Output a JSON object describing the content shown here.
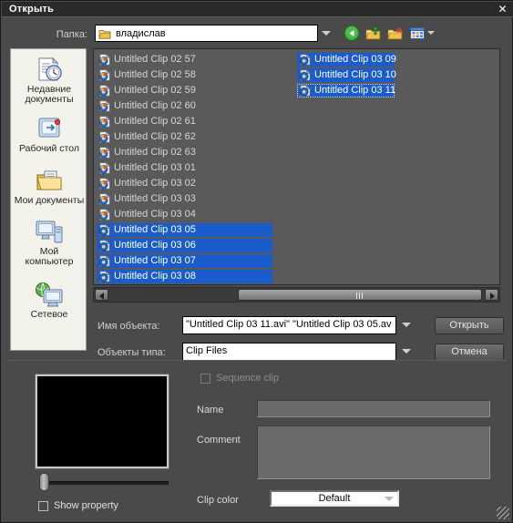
{
  "window": {
    "title": "Открыть",
    "close_label": "✕"
  },
  "toolbar": {
    "lookin_label": "Папка:",
    "lookin_value": "владислав",
    "icons": {
      "folder": "folder-icon",
      "back": "back-arrow-icon",
      "up": "up-one-level-icon",
      "new_folder": "new-folder-icon",
      "views": "views-icon"
    }
  },
  "places": [
    {
      "label_line1": "Недавние",
      "label_line2": "документы",
      "icon": "recent-documents-icon"
    },
    {
      "label_line1": "Рабочий стол",
      "label_line2": "",
      "icon": "desktop-icon"
    },
    {
      "label_line1": "Мои документы",
      "label_line2": "",
      "icon": "my-documents-icon"
    },
    {
      "label_line1": "Мой",
      "label_line2": "компьютер",
      "icon": "my-computer-icon"
    },
    {
      "label_line1": "Сетевое",
      "label_line2": "",
      "icon": "network-icon"
    }
  ],
  "files": {
    "column1": [
      {
        "name": "Untitled Clip 02 57",
        "selected": false,
        "focused": false
      },
      {
        "name": "Untitled Clip 02 58",
        "selected": false,
        "focused": false
      },
      {
        "name": "Untitled Clip 02 59",
        "selected": false,
        "focused": false
      },
      {
        "name": "Untitled Clip 02 60",
        "selected": false,
        "focused": false
      },
      {
        "name": "Untitled Clip 02 61",
        "selected": false,
        "focused": false
      },
      {
        "name": "Untitled Clip 02 62",
        "selected": false,
        "focused": false
      },
      {
        "name": "Untitled Clip 02 63",
        "selected": false,
        "focused": false
      },
      {
        "name": "Untitled Clip 03 01",
        "selected": false,
        "focused": false
      },
      {
        "name": "Untitled Clip 03 02",
        "selected": false,
        "focused": false
      },
      {
        "name": "Untitled Clip 03 03",
        "selected": false,
        "focused": false
      },
      {
        "name": "Untitled Clip 03 04",
        "selected": false,
        "focused": false
      },
      {
        "name": "Untitled Clip 03 05",
        "selected": true,
        "focused": false
      },
      {
        "name": "Untitled Clip 03 06",
        "selected": true,
        "focused": false
      },
      {
        "name": "Untitled Clip 03 07",
        "selected": true,
        "focused": false
      },
      {
        "name": "Untitled Clip 03 08",
        "selected": true,
        "focused": false
      }
    ],
    "column2": [
      {
        "name": "Untitled Clip 03 09",
        "selected": true,
        "focused": false
      },
      {
        "name": "Untitled Clip 03 10",
        "selected": true,
        "focused": false
      },
      {
        "name": "Untitled Clip 03 11",
        "selected": true,
        "focused": true
      }
    ]
  },
  "form": {
    "filename_label": "Имя объекта:",
    "filename_value": "\"Untitled Clip 03 11.avi\" \"Untitled Clip 03 05.av",
    "filetype_label": "Объекты типа:",
    "filetype_value": "Clip Files",
    "open_button": "Открыть",
    "cancel_button": "Отмена"
  },
  "options": {
    "sequence_clip_label": "Sequence clip",
    "sequence_clip_checked": false,
    "name_label": "Name",
    "name_value": "",
    "comment_label": "Comment",
    "comment_value": "",
    "clip_color_label": "Clip color",
    "clip_color_value": "Default",
    "show_property_label": "Show property",
    "show_property_checked": false
  },
  "colors": {
    "window_bg": "#4a4a4a",
    "titlebar_bg": "#2a2a2a",
    "selection_blue": "#1a5ccc",
    "places_bg": "#f3f2ea",
    "list_bg": "#5a5a5a",
    "preview_bg": "#000000"
  }
}
